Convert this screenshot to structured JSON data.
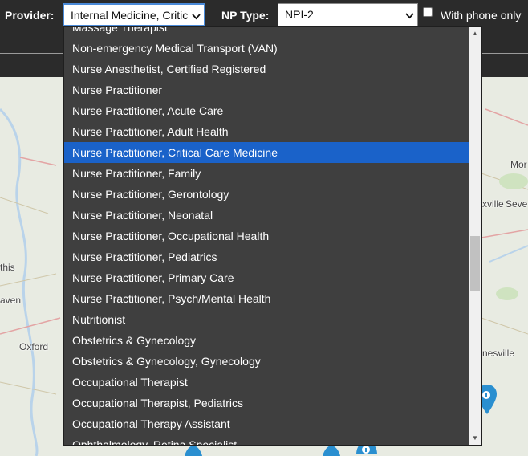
{
  "filters": {
    "provider_label": "Provider:",
    "provider_value": "Internal Medicine, Critic",
    "np_type_label": "NP Type:",
    "np_type_value": "NPI-2",
    "phone_label": "With phone only",
    "phone_checked": false
  },
  "map": {
    "labels": [
      "this",
      "aven",
      "Oxford",
      "Mor",
      "xville",
      "Seve",
      "nesville"
    ]
  },
  "dropdown": {
    "options": [
      "Massage Therapist",
      "Non-emergency Medical Transport (VAN)",
      "Nurse Anesthetist, Certified Registered",
      "Nurse Practitioner",
      "Nurse Practitioner, Acute Care",
      "Nurse Practitioner, Adult Health",
      "Nurse Practitioner, Critical Care Medicine",
      "Nurse Practitioner, Family",
      "Nurse Practitioner, Gerontology",
      "Nurse Practitioner, Neonatal",
      "Nurse Practitioner, Occupational Health",
      "Nurse Practitioner, Pediatrics",
      "Nurse Practitioner, Primary Care",
      "Nurse Practitioner, Psych/Mental Health",
      "Nutritionist",
      "Obstetrics & Gynecology",
      "Obstetrics & Gynecology, Gynecology",
      "Occupational Therapist",
      "Occupational Therapist, Pediatrics",
      "Occupational Therapy Assistant",
      "Ophthalmology, Retina Specialist"
    ],
    "selected": "Nurse Practitioner, Critical Care Medicine",
    "scroll_up_icon": "triangle-up-icon",
    "scroll_down_icon": "triangle-down-icon"
  },
  "colors": {
    "toolbar_bg": "#2b2b2b",
    "list_bg": "#3f3f3f",
    "highlight": "#1a62c9",
    "marker": "#2a8fd0"
  }
}
